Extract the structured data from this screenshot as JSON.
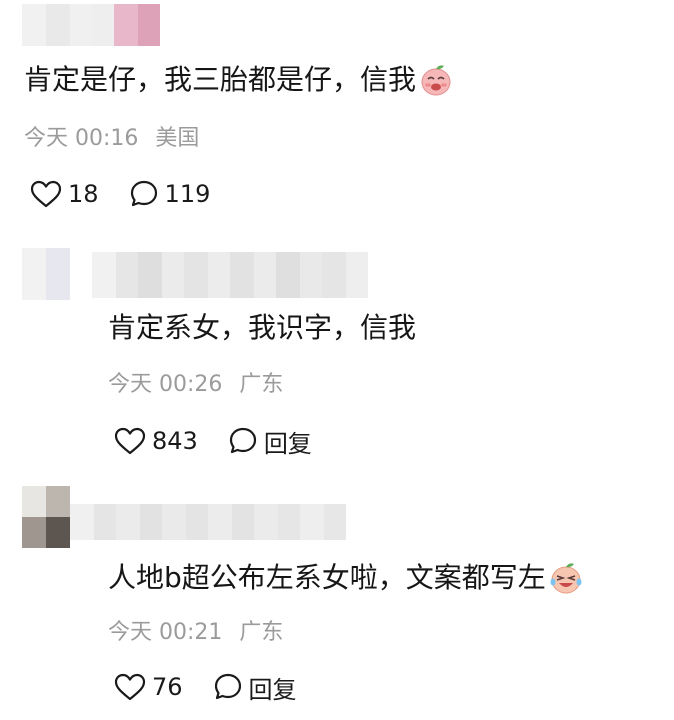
{
  "comments": [
    {
      "text": "肯定是仔，我三胎都是仔，信我",
      "time": "今天 00:16",
      "location": "美国",
      "likes": "18",
      "replies": "119",
      "emoji": "laughing-peach-emoji"
    },
    {
      "text": "肯定系女，我识字，信我",
      "time": "今天 00:26",
      "location": "广东",
      "likes": "843",
      "reply_label": "回复"
    },
    {
      "text": "人地b超公布左系女啦，文案都写左",
      "time": "今天 00:21",
      "location": "广东",
      "likes": "76",
      "reply_label": "回复",
      "emoji": "crying-laughing-peach-emoji"
    }
  ],
  "colors": {
    "text": "#161616",
    "meta": "#9b9b9b",
    "blur_light": "#ececec",
    "blur_pink": "#e4b3c6"
  }
}
